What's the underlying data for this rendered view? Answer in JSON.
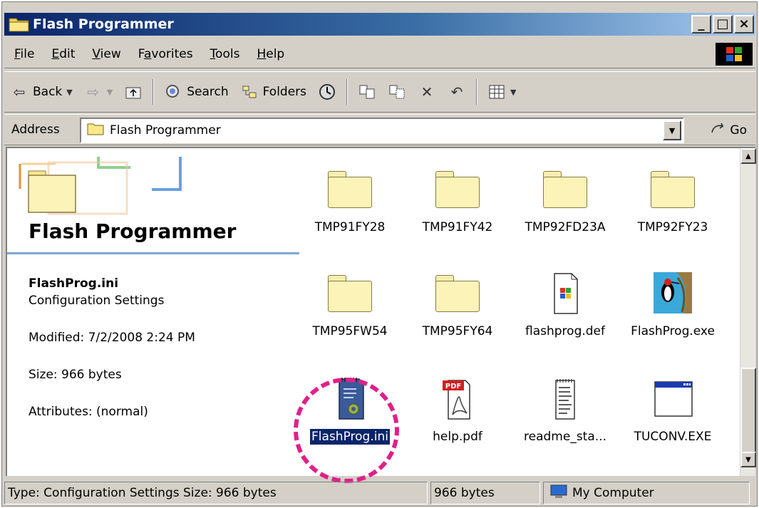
{
  "window": {
    "title": "Flash Programmer"
  },
  "caption_buttons": {
    "minimize": "_",
    "maximize": "□",
    "close": "×"
  },
  "menu": [
    {
      "label": "File",
      "key": "F"
    },
    {
      "label": "Edit",
      "key": "E"
    },
    {
      "label": "View",
      "key": "V"
    },
    {
      "label": "Favorites",
      "key": "a"
    },
    {
      "label": "Tools",
      "key": "T"
    },
    {
      "label": "Help",
      "key": "H"
    }
  ],
  "toolbar": {
    "back_label": "Back",
    "search_label": "Search",
    "folders_label": "Folders"
  },
  "address": {
    "label": "Address",
    "value": "Flash Programmer",
    "go_label": "Go"
  },
  "leftpane": {
    "title": "Flash Programmer",
    "file_name": "FlashProg.ini",
    "file_type": "Configuration Settings",
    "modified": "Modified: 7/2/2008 2:24 PM",
    "size": "Size: 966 bytes",
    "attributes": "Attributes: (normal)"
  },
  "items": [
    {
      "label": "TMP91FY28",
      "icon": "folder-icon"
    },
    {
      "label": "TMP91FY42",
      "icon": "folder-icon"
    },
    {
      "label": "TMP92FD23A",
      "icon": "folder-icon"
    },
    {
      "label": "TMP92FY23",
      "icon": "folder-icon"
    },
    {
      "label": "TMP95FW54",
      "icon": "folder-icon"
    },
    {
      "label": "TMP95FY64",
      "icon": "folder-icon"
    },
    {
      "label": "flashprog.def",
      "icon": "windows-file-icon"
    },
    {
      "label": "FlashProg.exe",
      "icon": "woodpecker-app-icon"
    },
    {
      "label": "FlashProg.ini",
      "icon": "settings-file-icon",
      "selected": true
    },
    {
      "label": "help.pdf",
      "icon": "pdf-file-icon"
    },
    {
      "label": "readme_sta...",
      "icon": "text-file-icon"
    },
    {
      "label": "TUCONV.EXE",
      "icon": "window-app-icon"
    }
  ],
  "statusbar": {
    "info": "Type: Configuration Settings Size: 966 bytes",
    "size": "966 bytes",
    "zone": "My Computer"
  },
  "colors": {
    "selection": "#0a246a",
    "highlight_circle": "#e0208a",
    "title_gradient_start": "#0a246a"
  }
}
